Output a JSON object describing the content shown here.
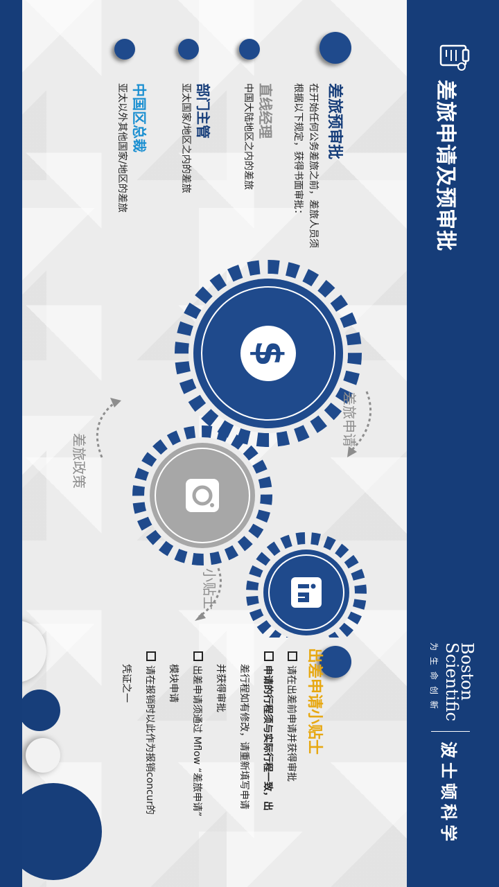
{
  "header": {
    "title": "差旅申请及预审批",
    "brand_en_1": "Boston",
    "brand_en_2": "Scientific",
    "brand_en_tagline": "为生命创新",
    "brand_zh": "波士顿科学"
  },
  "left": {
    "heading": "差旅预审批",
    "intro_1": "在开始任何公务差旅之前，差旅人员须",
    "intro_2": "根据以下规定，获得书面审批：",
    "items": [
      {
        "title": "直线经理",
        "text": "中国大陆地区之内的差旅"
      },
      {
        "title": "部门主管",
        "text": "亚太国家/地区之内的差旅"
      },
      {
        "title": "中国区总裁",
        "text": "亚太以外其他国家/地区的差旅"
      }
    ]
  },
  "gears": {
    "label_top": "差旅申请",
    "label_bottom": "差旅政策",
    "label_tips": "小贴士"
  },
  "right": {
    "heading": "出差申请小贴士",
    "line_1": "请在出差前申请并获得审批",
    "line_2": "申请的行程须与实际行程一致，出",
    "line_3": "差行程如有修改，请重新填写申请",
    "line_4": "并获得审批",
    "line_5": "出差申请须通过 Mflow “差旅申请”",
    "line_6": "模块申请",
    "line_7": "请在报销时以此作为报销concur的",
    "line_8": "凭证之一"
  },
  "colors": {
    "navy": "#173e7a",
    "gear_blue": "#1f4a8c",
    "gear_gray": "#a7a7a7",
    "accent_cyan": "#1a8fd1",
    "accent_gold": "#e7a812",
    "muted_text": "#8d8d8d"
  }
}
